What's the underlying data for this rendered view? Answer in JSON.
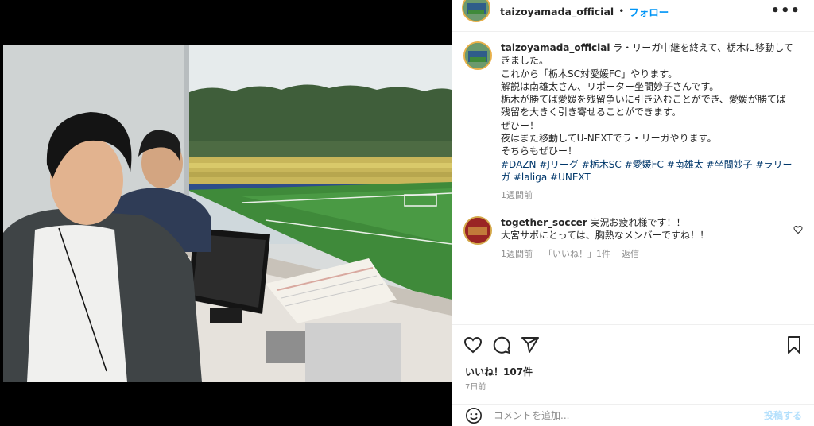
{
  "post": {
    "username": "taizoyamada_official",
    "dot": "•",
    "follow_label": "フォロー",
    "more_label": "•••"
  },
  "caption": {
    "username": "taizoyamada_official",
    "text": "ラ・リーガ中継を終えて、栃木に移動してきました。\nこれから「栃木SC対愛媛FC」やります。\n解説は南雄太さん、リポーター坐間妙子さんです。\n栃木が勝てば愛媛を残留争いに引き込むことができ、愛媛が勝てば残留を大きく引き寄せることができます。\nぜひー！\n夜はまた移動してU-NEXTでラ・リーガやります。\nそちらもぜひー！",
    "hashtags": "#DAZN #Jリーグ #栃木SC #愛媛FC #南雄太 #坐間妙子 #ラリーガ #laliga #UNEXT",
    "time": "1週間前"
  },
  "comment": {
    "username": "together_soccer",
    "text": "実況お疲れ様です！！\n大宮サポにとっては、胸熱なメンバーですね！！",
    "time": "1週間前",
    "likes": "「いいね！」1件",
    "reply": "返信"
  },
  "likes_count": "いいね！107件",
  "date": "7日前",
  "compose": {
    "placeholder": "コメントを追加...",
    "post_label": "投稿する"
  },
  "colors": {
    "accent": "#0095f6",
    "hashtag": "#00376b",
    "muted": "#8e8e8e",
    "post_disabled": "#b2dffc"
  }
}
